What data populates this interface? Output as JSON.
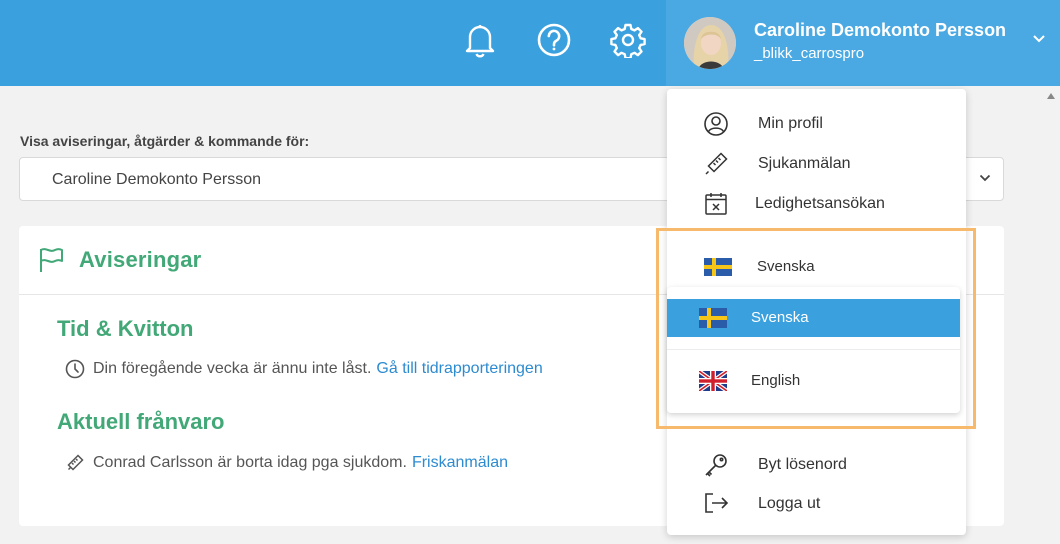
{
  "header": {
    "user_name": "Caroline Demokonto Persson",
    "user_handle": "_blikk_carrospro",
    "icons": [
      "bell-icon",
      "help-icon",
      "gear-icon",
      "chevron-down-icon"
    ],
    "colors": {
      "bar": "#3aa0de",
      "user_area": "#4aa9e2"
    }
  },
  "filter": {
    "label": "Visa aviseringar, åtgärder & kommande för:",
    "selected": "Caroline Demokonto Persson"
  },
  "card": {
    "title": "Aviseringar",
    "sections": [
      {
        "title": "Tid & Kvitton",
        "text": "Din föregående vecka är ännu inte låst.",
        "link": "Gå till tidrapporteringen",
        "icon": "clock-icon"
      },
      {
        "title": "Aktuell frånvaro",
        "text": "Conrad Carlsson är borta idag pga sjukdom.",
        "link": "Friskanmälan",
        "icon": "thermometer-icon"
      }
    ],
    "accent": "#42a877",
    "link_color": "#2d8bd0"
  },
  "menu": {
    "items_top": [
      {
        "label": "Min profil",
        "icon": "user-circle-icon"
      },
      {
        "label": "Sjukanmälan",
        "icon": "thermometer-icon"
      },
      {
        "label": "Ledighetsansökan",
        "icon": "calendar-x-icon"
      }
    ],
    "language": {
      "current": "Svenska",
      "options": [
        {
          "label": "Svenska",
          "flag": "sweden-flag-icon",
          "selected": true
        },
        {
          "label": "English",
          "flag": "uk-flag-icon",
          "selected": false
        }
      ]
    },
    "items_bottom": [
      {
        "label": "Byt lösenord",
        "icon": "key-icon"
      },
      {
        "label": "Logga ut",
        "icon": "logout-icon"
      }
    ],
    "highlight_color": "#f7b96b"
  }
}
